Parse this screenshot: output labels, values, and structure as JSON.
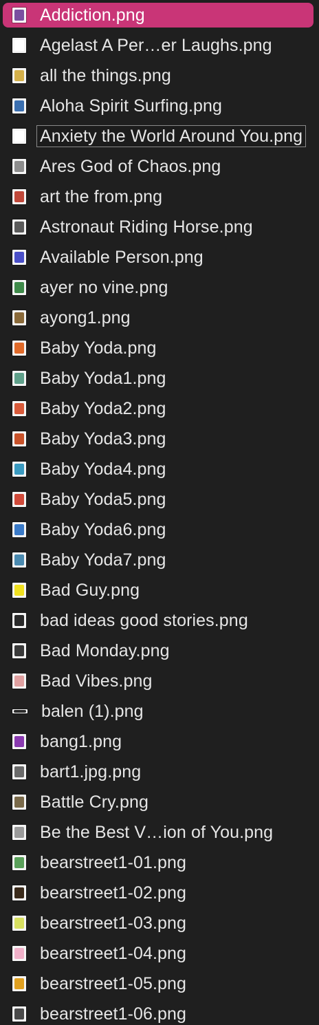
{
  "files": [
    {
      "name": "Addiction.png",
      "icon": "image-thumbnail-icon",
      "art": "#7a4fa0",
      "selected": true
    },
    {
      "name": "Agelast A Per…er Laughs.png",
      "icon": "image-thumbnail-icon",
      "art": "#ffffff"
    },
    {
      "name": "all the things.png",
      "icon": "image-thumbnail-icon",
      "art": "#d4b04a"
    },
    {
      "name": "Aloha Spirit Surfing.png",
      "icon": "image-thumbnail-icon",
      "art": "#3a6fb0"
    },
    {
      "name": "Anxiety the World Around You.png",
      "icon": "image-thumbnail-icon",
      "art": "#ffffff",
      "editing": true
    },
    {
      "name": "Ares God of Chaos.png",
      "icon": "image-thumbnail-icon",
      "art": "#8d8d8d"
    },
    {
      "name": "art the from.png",
      "icon": "image-thumbnail-icon",
      "art": "#c0483a"
    },
    {
      "name": "Astronaut Riding Horse.png",
      "icon": "image-thumbnail-icon",
      "art": "#5a5a5a"
    },
    {
      "name": "Available Person.png",
      "icon": "image-thumbnail-icon",
      "art": "#4a4fc8"
    },
    {
      "name": "ayer no vine.png",
      "icon": "image-thumbnail-icon",
      "art": "#3f8a4a"
    },
    {
      "name": "ayong1.png",
      "icon": "image-thumbnail-icon",
      "art": "#8a6a3a"
    },
    {
      "name": "Baby Yoda.png",
      "icon": "image-thumbnail-icon",
      "art": "#e06a2a"
    },
    {
      "name": "Baby Yoda1.png",
      "icon": "image-thumbnail-icon",
      "art": "#5fa08a"
    },
    {
      "name": "Baby Yoda2.png",
      "icon": "image-thumbnail-icon",
      "art": "#d85a3a"
    },
    {
      "name": "Baby Yoda3.png",
      "icon": "image-thumbnail-icon",
      "art": "#c8522a"
    },
    {
      "name": "Baby Yoda4.png",
      "icon": "image-thumbnail-icon",
      "art": "#3a9ac0"
    },
    {
      "name": "Baby Yoda5.png",
      "icon": "image-thumbnail-icon",
      "art": "#d04a3a"
    },
    {
      "name": "Baby Yoda6.png",
      "icon": "image-thumbnail-icon",
      "art": "#3a7ac8"
    },
    {
      "name": "Baby Yoda7.png",
      "icon": "image-thumbnail-icon",
      "art": "#4a8ab0"
    },
    {
      "name": "Bad Guy.png",
      "icon": "image-thumbnail-icon",
      "art": "#f0e020"
    },
    {
      "name": "bad ideas good stories.png",
      "icon": "image-thumbnail-icon",
      "art": "#2a2a2a"
    },
    {
      "name": "Bad Monday.png",
      "icon": "image-thumbnail-icon",
      "art": "#3a3a3a"
    },
    {
      "name": "Bad Vibes.png",
      "icon": "image-thumbnail-icon",
      "art": "#e0a0a0"
    },
    {
      "name": "balen (1).png",
      "icon": "image-thumbnail-icon",
      "art": "#2a2a2a",
      "wide": true
    },
    {
      "name": "bang1.png",
      "icon": "image-thumbnail-icon",
      "art": "#8a3ab0"
    },
    {
      "name": "bart1.jpg.png",
      "icon": "image-thumbnail-icon",
      "art": "#6a6a6a"
    },
    {
      "name": "Battle Cry.png",
      "icon": "image-thumbnail-icon",
      "art": "#7a6a4a"
    },
    {
      "name": "Be the Best V…ion of You.png",
      "icon": "image-thumbnail-icon",
      "art": "#9a9a9a"
    },
    {
      "name": "bearstreet1-01.png",
      "icon": "image-thumbnail-icon",
      "art": "#5aa05a"
    },
    {
      "name": "bearstreet1-02.png",
      "icon": "image-thumbnail-icon",
      "art": "#3a2a1a"
    },
    {
      "name": "bearstreet1-03.png",
      "icon": "image-thumbnail-icon",
      "art": "#d8e060"
    },
    {
      "name": "bearstreet1-04.png",
      "icon": "image-thumbnail-icon",
      "art": "#f0b0c8"
    },
    {
      "name": "bearstreet1-05.png",
      "icon": "image-thumbnail-icon",
      "art": "#e0a020"
    },
    {
      "name": "bearstreet1-06.png",
      "icon": "image-thumbnail-icon",
      "art": "#4a4a4a"
    }
  ]
}
